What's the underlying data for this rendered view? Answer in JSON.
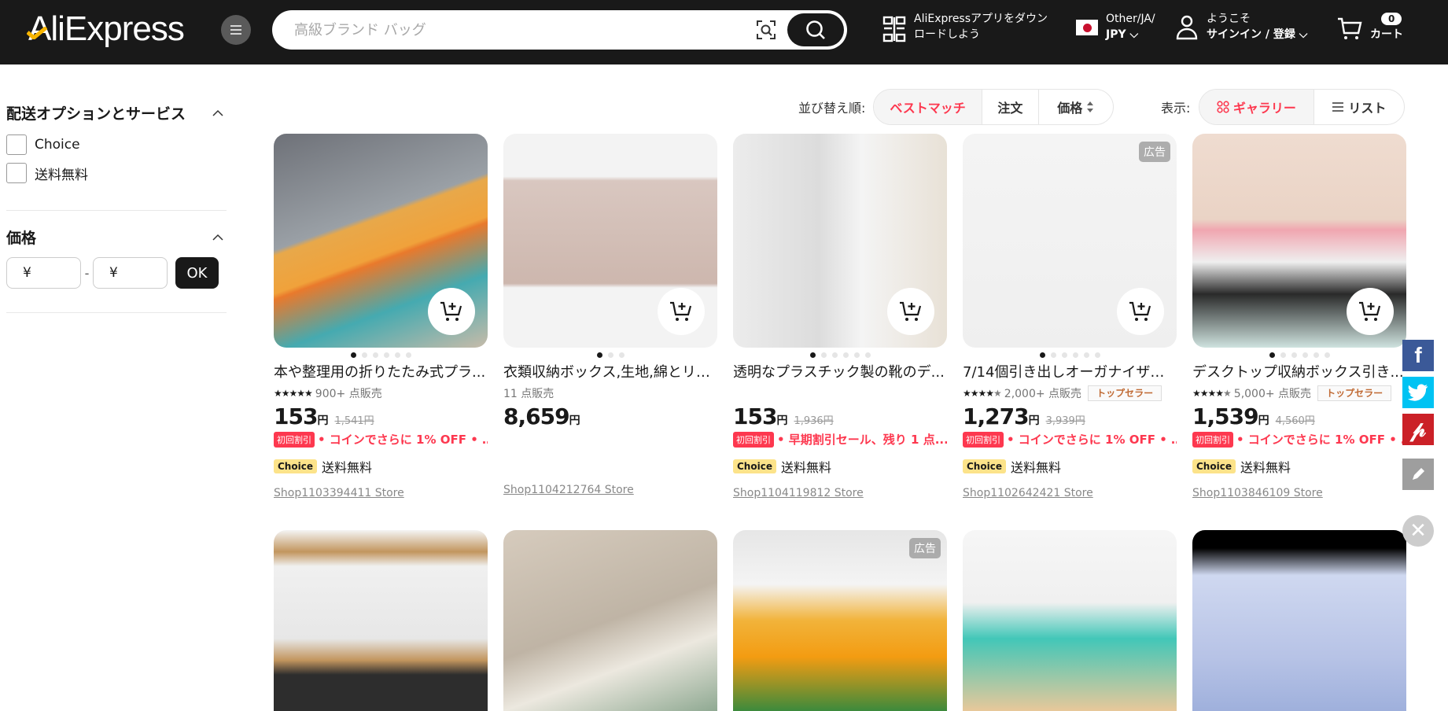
{
  "header": {
    "logo": "AliExpress",
    "search_placeholder": "高級ブランド バッグ",
    "app_download_line1": "AliExpressアプリをダウン",
    "app_download_line2": "ロードしよう",
    "region_line1": "Other/JA/",
    "region_currency": "JPY",
    "welcome": "ようこそ",
    "signin": "サインイン / 登録",
    "cart_count": "0",
    "cart_label": "カート"
  },
  "sidebar": {
    "shipping_title": "配送オプションとサービス",
    "shipping_options": [
      "Choice",
      "送料無料"
    ],
    "price_title": "価格",
    "price_min_placeholder": "¥",
    "price_max_placeholder": "¥",
    "price_sep": "-",
    "ok_label": "OK"
  },
  "sortbar": {
    "sort_label": "並び替え順:",
    "sort_options": [
      "ベストマッチ",
      "注文",
      "価格"
    ],
    "active_sort": "ベストマッチ",
    "view_label": "表示:",
    "view_options": [
      "ギャラリー",
      "リスト"
    ],
    "active_view": "ギャラリー"
  },
  "colors": {
    "accent": "#fd384f",
    "header_bg": "#191919",
    "choice_badge": "#fce38a",
    "facebook": "#3b5998",
    "twitter": "#00c3f3",
    "pinterest": "#cb2027"
  },
  "products": [
    {
      "title": "本や整理用の折りたたみ式プラ...",
      "rating": 5,
      "sold": "900+ 点販売",
      "price": "153",
      "currency": "円",
      "original": "1,541円",
      "promo_tag": "初回割引",
      "promo": "• コインでさらに 1% OFF • …",
      "choice": "Choice",
      "shipping": "送料無料",
      "store": "Shop1103394411 Store",
      "ad": "",
      "top_seller": "",
      "dots": 6
    },
    {
      "title": "衣類収納ボックス,生地,綿とリネ...",
      "rating": 0,
      "sold": "11 点販売",
      "price": "8,659",
      "currency": "円",
      "original": "",
      "promo_tag": "",
      "promo": "",
      "choice": "",
      "shipping": "",
      "store": "Shop1104212764 Store",
      "ad": "",
      "top_seller": "",
      "dots": 3
    },
    {
      "title": "透明なプラスチック製の靴のデ...",
      "rating": 0,
      "sold": "",
      "price": "153",
      "currency": "円",
      "original": "1,936円",
      "promo_tag": "初回割引",
      "promo": "• 早期割引セール、残り 1 点...",
      "choice": "Choice",
      "shipping": "送料無料",
      "store": "Shop1104119812 Store",
      "ad": "",
      "top_seller": "",
      "dots": 6
    },
    {
      "title": "7/14個引き出しオーガナイザー...",
      "rating": 4.5,
      "sold": "2,000+ 点販売",
      "price": "1,273",
      "currency": "円",
      "original": "3,939円",
      "promo_tag": "初回割引",
      "promo": "• コインでさらに 1% OFF • …",
      "choice": "Choice",
      "shipping": "送料無料",
      "store": "Shop1102642421 Store",
      "ad": "広告",
      "top_seller": "トップセラー",
      "dots": 6
    },
    {
      "title": "デスクトップ収納ボックス引き...",
      "rating": 4.5,
      "sold": "5,000+ 点販売",
      "price": "1,539",
      "currency": "円",
      "original": "4,560円",
      "promo_tag": "初回割引",
      "promo": "• コインでさらに 1% OFF • …",
      "choice": "Choice",
      "shipping": "送料無料",
      "store": "Shop1103846109 Store",
      "ad": "",
      "top_seller": "トップセラー",
      "dots": 6
    }
  ],
  "row2": [
    {
      "ad": ""
    },
    {
      "ad": ""
    },
    {
      "ad": "広告"
    },
    {
      "ad": ""
    },
    {
      "ad": ""
    }
  ],
  "share": [
    "facebook",
    "twitter",
    "pinterest",
    "edit"
  ]
}
